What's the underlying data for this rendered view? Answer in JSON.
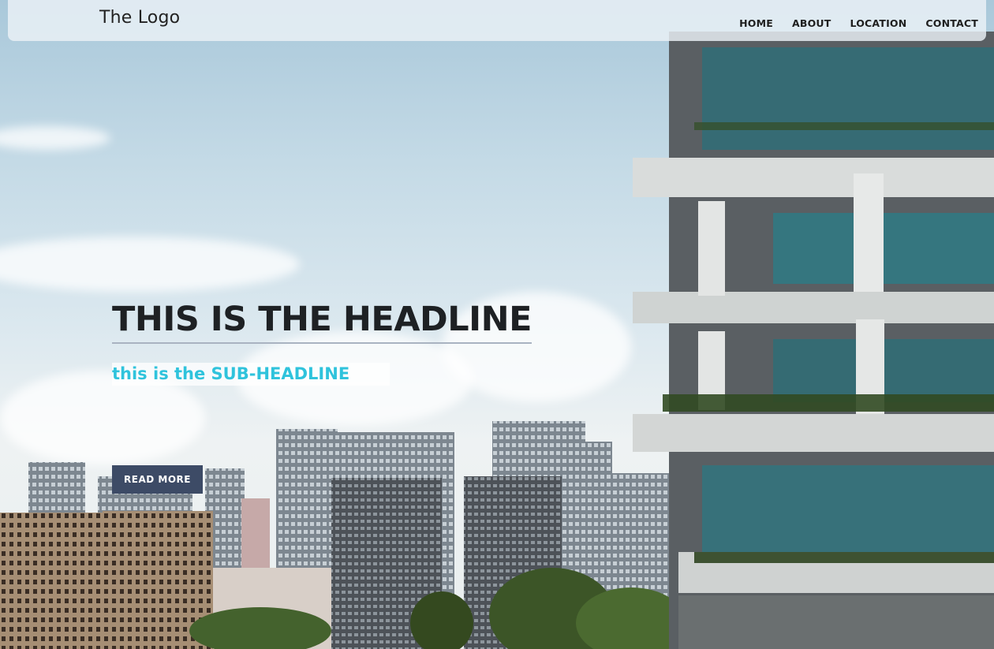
{
  "header": {
    "logo": "The Logo",
    "nav": [
      "HOME",
      "ABOUT",
      "LOCATION",
      "CONTACT"
    ]
  },
  "hero": {
    "headline": "THIS IS THE HEADLINE",
    "subheadline": "this is the SUB-HEADLINE",
    "button_label": "READ MORE"
  },
  "colors": {
    "subheadline": "#2fc3dc",
    "button_bg": "#3d4b66",
    "headline": "#1e2124"
  },
  "background_image": "city skyline with modern green-terrace building"
}
